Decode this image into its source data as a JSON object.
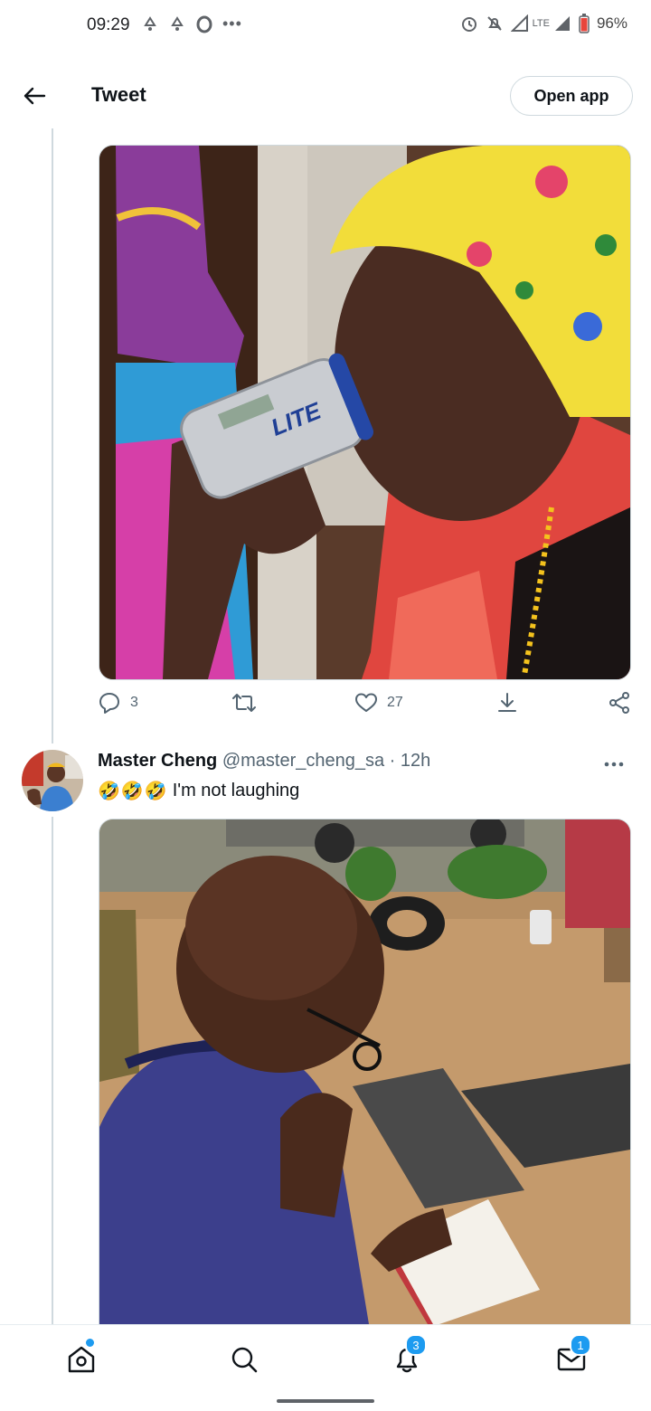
{
  "status_bar": {
    "time": "09:29",
    "network": "LTE",
    "battery": "96%"
  },
  "header": {
    "title": "Tweet",
    "open_app_label": "Open app"
  },
  "tweet": {
    "reply_count": "3",
    "like_count": "27",
    "image_text": "LITE"
  },
  "reply": {
    "name": "Master Cheng",
    "handle": "@master_cheng_sa",
    "separator": "·",
    "time": "12h",
    "emojis": [
      "🤣",
      "🤣",
      "🤣"
    ],
    "text": "I'm not laughing"
  },
  "nav": {
    "notifications_badge": "3",
    "messages_badge": "1"
  },
  "colors": {
    "accent": "#1d9bf0",
    "text": "#0f1419",
    "muted": "#536471",
    "border": "#cfd9de"
  }
}
